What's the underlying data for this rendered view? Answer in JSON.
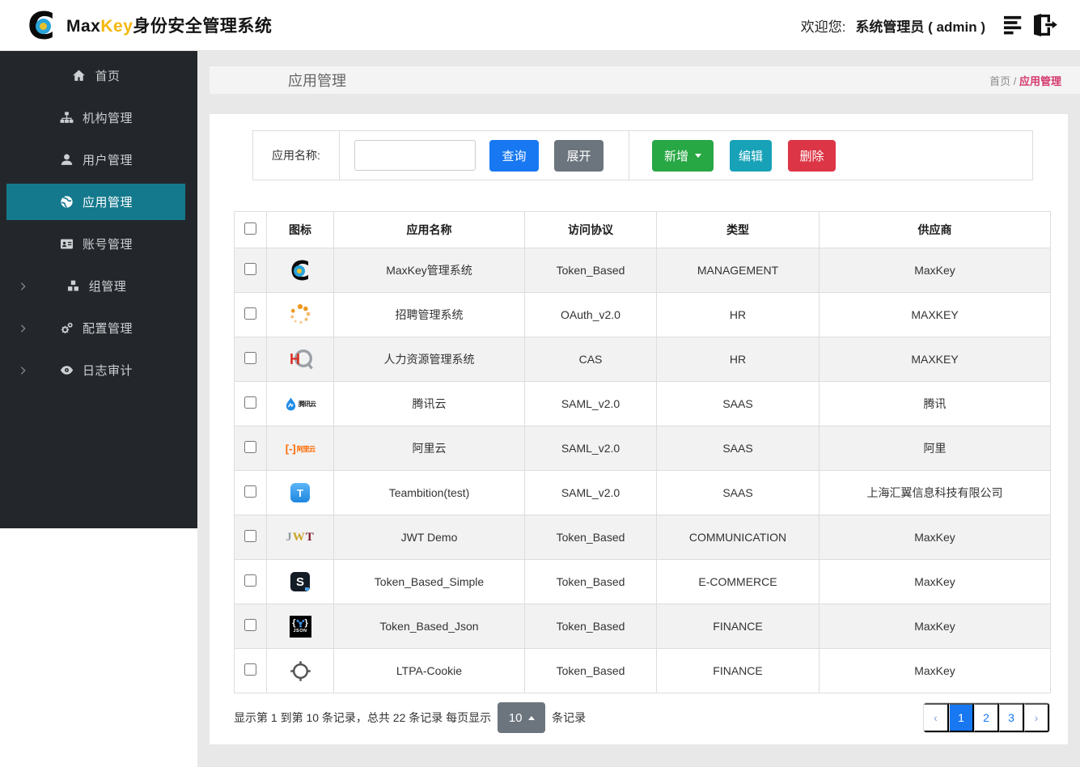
{
  "brand": {
    "name_black": "Max",
    "name_accent": "Key",
    "name_suffix": "身份安全管理系统"
  },
  "header": {
    "welcome_label": "欢迎您:",
    "username": "系统管理员 ( admin )",
    "icons": [
      "list-icon",
      "logout-icon"
    ]
  },
  "sidebar": {
    "items": [
      {
        "id": "home",
        "label": "首页",
        "icon": "home-icon",
        "active": false,
        "expandable": false
      },
      {
        "id": "org",
        "label": "机构管理",
        "icon": "sitemap-icon",
        "active": false,
        "expandable": false
      },
      {
        "id": "user",
        "label": "用户管理",
        "icon": "user-icon",
        "active": false,
        "expandable": false
      },
      {
        "id": "app",
        "label": "应用管理",
        "icon": "globe-icon",
        "active": true,
        "expandable": false
      },
      {
        "id": "account",
        "label": "账号管理",
        "icon": "id-card-icon",
        "active": false,
        "expandable": false
      },
      {
        "id": "group",
        "label": "组管理",
        "icon": "cubes-icon",
        "active": false,
        "expandable": true
      },
      {
        "id": "config",
        "label": "配置管理",
        "icon": "cogs-icon",
        "active": false,
        "expandable": true
      },
      {
        "id": "audit",
        "label": "日志审计",
        "icon": "eye-icon",
        "active": false,
        "expandable": true
      }
    ]
  },
  "page": {
    "title": "应用管理",
    "breadcrumb": {
      "root": "首页",
      "separator": " / ",
      "current": "应用管理"
    }
  },
  "toolbar": {
    "search_label": "应用名称:",
    "search_value": "",
    "query_label": "查询",
    "expand_label": "展开",
    "add_label": "新增",
    "edit_label": "编辑",
    "delete_label": "删除"
  },
  "table": {
    "columns": [
      "图标",
      "应用名称",
      "访问协议",
      "类型",
      "供应商"
    ],
    "rows": [
      {
        "icon": "maxkey-logo",
        "name": "MaxKey管理系统",
        "protocol": "Token_Based",
        "type": "MANAGEMENT",
        "vendor": "MaxKey"
      },
      {
        "icon": "dots-spinner-logo",
        "name": "招聘管理系统",
        "protocol": "OAuth_v2.0",
        "type": "HR",
        "vendor": "MAXKEY"
      },
      {
        "icon": "hr-logo",
        "name": "人力资源管理系统",
        "protocol": "CAS",
        "type": "HR",
        "vendor": "MAXKEY"
      },
      {
        "icon": "tencent-cloud-logo",
        "name": "腾讯云",
        "protocol": "SAML_v2.0",
        "type": "SAAS",
        "vendor": "腾讯"
      },
      {
        "icon": "alibaba-cloud-logo",
        "name": "阿里云",
        "protocol": "SAML_v2.0",
        "type": "SAAS",
        "vendor": "阿里"
      },
      {
        "icon": "teambition-logo",
        "name": "Teambition(test)",
        "protocol": "SAML_v2.0",
        "type": "SAAS",
        "vendor": "上海汇翼信息科技有限公司"
      },
      {
        "icon": "jwt-logo",
        "name": "JWT Demo",
        "protocol": "Token_Based",
        "type": "COMMUNICATION",
        "vendor": "MaxKey"
      },
      {
        "icon": "s-letter-logo",
        "name": "Token_Based_Simple",
        "protocol": "Token_Based",
        "type": "E-COMMERCE",
        "vendor": "MaxKey"
      },
      {
        "icon": "json-logo",
        "name": "Token_Based_Json",
        "protocol": "Token_Based",
        "type": "FINANCE",
        "vendor": "MaxKey"
      },
      {
        "icon": "ltpa-crosshair-logo",
        "name": "LTPA-Cookie",
        "protocol": "Token_Based",
        "type": "FINANCE",
        "vendor": "MaxKey"
      }
    ]
  },
  "footer": {
    "summary_prefix": "显示第 1 到第 10 条记录，总共 22 条记录 每页显示",
    "page_size": "10",
    "summary_suffix": "条记录",
    "prev": "‹",
    "next": "›",
    "pages": [
      "1",
      "2",
      "3"
    ],
    "active_page": "1"
  },
  "icon_text": {
    "maxkey_c": "C",
    "tencent": "腾讯云",
    "ali_bracket": "[-]",
    "ali": "阿里云",
    "teambition": "T",
    "jwt": [
      "J",
      "W",
      "T"
    ],
    "s": "S",
    "json": "JSON",
    "hr": "H"
  },
  "colors": {
    "primary": "#1778f2",
    "success": "#28a745",
    "info": "#17a2b8",
    "danger": "#dc3545",
    "secondary": "#6c757d",
    "sidebar_active": "#14798c",
    "breadcrumb_active": "#d5396f",
    "brand_accent": "#f5b80f"
  }
}
